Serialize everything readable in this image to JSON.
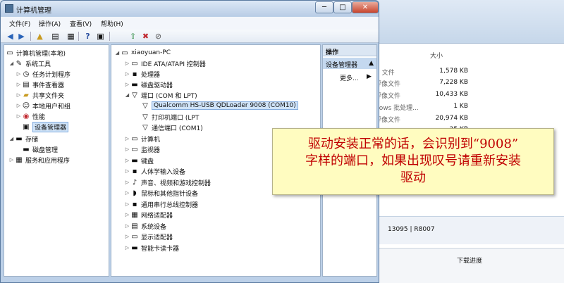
{
  "window": {
    "title": "计算机管理",
    "min": "─",
    "max": "□",
    "close": "✕"
  },
  "menus": [
    "文件(F)",
    "操作(A)",
    "查看(V)",
    "帮助(H)"
  ],
  "toolbar_icons": [
    "back-arrow-icon",
    "forward-arrow-icon",
    "up-folder-icon",
    "show-hide-tree-icon",
    "properties-icon",
    "help-icon",
    "view-icon",
    "update-driver-icon",
    "disable-icon",
    "uninstall-icon"
  ],
  "left_tree": {
    "root": "计算机管理(本地)",
    "system_tools": "系统工具",
    "task_scheduler": "任务计划程序",
    "event_viewer": "事件查看器",
    "shared_folders": "共享文件夹",
    "local_users": "本地用户和组",
    "performance": "性能",
    "device_manager": "设备管理器",
    "storage": "存储",
    "disk_management": "磁盘管理",
    "services": "服务和应用程序"
  },
  "device_tree": {
    "root": "xiaoyuan-PC",
    "ide": "IDE ATA/ATAPI 控制器",
    "cpu": "处理器",
    "disk": "磁盘驱动器",
    "ports": "端口 (COM 和 LPT)",
    "qualcomm": "Qualcomm HS-USB QDLoader 9008 (COM10)",
    "lpt": "打印机端口 (LPT",
    "com1": "通信端口 (COM1)",
    "computer": "计算机",
    "monitor": "监视器",
    "keyboard": "键盘",
    "hid": "人体学输入设备",
    "audio": "声音、视频和游戏控制器",
    "mouse": "鼠标和其他指针设备",
    "usb": "通用串行总线控制器",
    "network": "网络适配器",
    "system": "系统设备",
    "display": "显示适配器",
    "smartcard": "智能卡读卡器"
  },
  "actions": {
    "header": "操作",
    "item": "设备管理器",
    "more": "更多..."
  },
  "callout": {
    "line1": "驱动安装正常的话，会识别到“9008”",
    "line2": "字样的端口，如果出现叹号请重新安装",
    "line3": "驱动"
  },
  "background": {
    "size_header": "大小",
    "rows": [
      {
        "type": "N 文件",
        "size": "1,578 KB"
      },
      {
        "type": "评像文件",
        "size": "7,228 KB"
      },
      {
        "type": "评像文件",
        "size": "10,433 KB"
      },
      {
        "type": "dows 批处理...",
        "size": "1 KB"
      },
      {
        "type": "评像文件",
        "size": "20,974 KB"
      },
      {
        "type": "",
        "size": "25 KB"
      }
    ],
    "status": "13095 | R8007",
    "taskbar": "下载进度"
  }
}
